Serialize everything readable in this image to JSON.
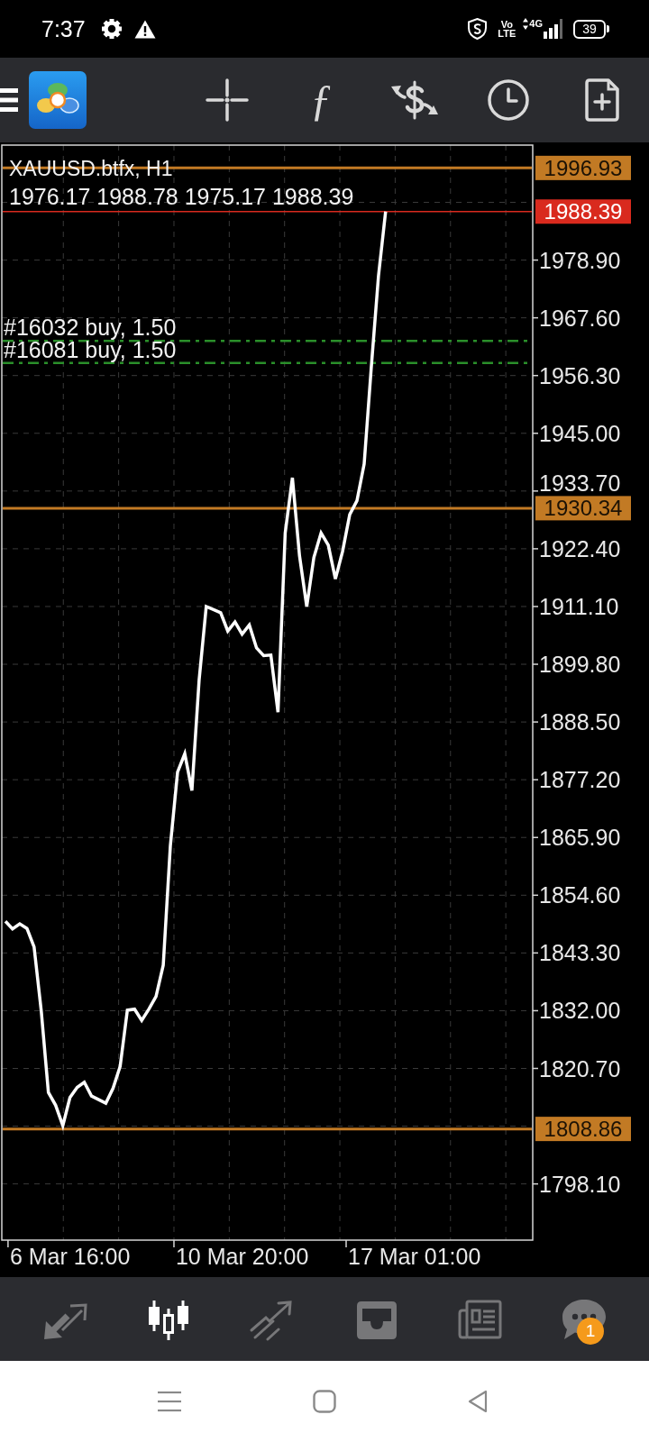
{
  "status_bar": {
    "time": "7:37",
    "volte_top": "Vo",
    "volte_bottom": "LTE",
    "network": "4G",
    "battery": "39"
  },
  "toolbar": {
    "function_symbol": "ƒ"
  },
  "chart": {
    "ohlc": "1976.17 1988.78 1975.17 1988.39",
    "chart_data": {
      "type": "line",
      "title": "XAUUSD.btfx, H1",
      "grid": true,
      "categories": [
        null,
        null,
        null,
        null,
        null,
        null,
        null,
        null,
        null,
        "6 Mar 16:00",
        null,
        null,
        null,
        null,
        null,
        null,
        null,
        null,
        null,
        null,
        null,
        null,
        null,
        null,
        null,
        null,
        null,
        null,
        null,
        null,
        null,
        null,
        null,
        "10 Mar 20:00",
        null,
        null,
        null,
        null,
        null,
        null,
        null,
        null,
        null,
        null,
        null,
        null,
        null,
        null,
        null,
        null,
        null,
        null,
        null,
        null,
        null,
        null,
        null,
        "17 Mar 01:00",
        null,
        null,
        null,
        null,
        null,
        null,
        null,
        null,
        null,
        null,
        null,
        null,
        null,
        null,
        null,
        null
      ],
      "series": [
        {
          "color": "#ffffff",
          "values": [
            1849.5,
            1848.0,
            1849.0,
            1848.1,
            1844.5,
            1831.9,
            1816.0,
            1813.5,
            1809.5,
            1815.0,
            1817.0,
            1818.0,
            1815.3,
            1814.6,
            1813.9,
            1816.8,
            1821.1,
            1832.1,
            1832.3,
            1830.1,
            1832.3,
            1834.8,
            1840.9,
            1864.3,
            1878.7,
            1882.3,
            1875.1,
            1896.7,
            1911.1,
            1910.5,
            1909.9,
            1906.3,
            1908.1,
            1905.7,
            1907.5,
            1903.0,
            1901.5,
            1901.6,
            1890.4,
            1925.5,
            1936.3,
            1921.0,
            1911.1,
            1920.7,
            1925.5,
            1923.1,
            1916.5,
            1921.9,
            1929.1,
            1931.8,
            1939.0,
            1957.9,
            1975.8,
            1988.4,
            null,
            null,
            null,
            null,
            null,
            null,
            null,
            null,
            null,
            null,
            null,
            null,
            null,
            null,
            null,
            null,
            null,
            null,
            null,
            null
          ]
        }
      ],
      "ylim": [
        1787.1,
        2001.4
      ],
      "yticks": [
        {
          "value": 1978.9,
          "label": "1978.90"
        },
        {
          "value": 1967.6,
          "label": "1967.60"
        },
        {
          "value": 1956.3,
          "label": "1956.30"
        },
        {
          "value": 1945.0,
          "label": "1945.00"
        },
        {
          "value": 1933.7,
          "label": "1933.70"
        },
        {
          "value": 1922.4,
          "label": "1922.40"
        },
        {
          "value": 1911.1,
          "label": "1911.10"
        },
        {
          "value": 1899.8,
          "label": "1899.80"
        },
        {
          "value": 1888.5,
          "label": "1888.50"
        },
        {
          "value": 1877.2,
          "label": "1877.20"
        },
        {
          "value": 1865.9,
          "label": "1865.90"
        },
        {
          "value": 1854.6,
          "label": "1854.60"
        },
        {
          "value": 1843.3,
          "label": "1843.30"
        },
        {
          "value": 1832.0,
          "label": "1832.00"
        },
        {
          "value": 1820.7,
          "label": "1820.70"
        },
        {
          "value": 1798.1,
          "label": "1798.10"
        }
      ],
      "ref_lines": [
        {
          "axis": "y",
          "value": 1996.93,
          "label": "1996.93",
          "color": "#c27a24"
        },
        {
          "axis": "y",
          "value": 1988.39,
          "label": "1988.39",
          "color": "#d92a1e"
        },
        {
          "axis": "y",
          "value": 1963.06,
          "color": "#2a8f2a"
        },
        {
          "axis": "y",
          "value": 1958.74,
          "color": "#2a8f2a"
        },
        {
          "axis": "y",
          "value": 1930.34,
          "label": "1930.34",
          "color": "#c27a24"
        },
        {
          "axis": "y",
          "value": 1808.86,
          "label": "1808.86",
          "color": "#c27a24"
        }
      ],
      "annotations": [
        "#16032 buy, 1.50",
        "#16081 buy, 1.50"
      ]
    }
  },
  "bottom_nav": {
    "items": [
      {
        "selected": false
      },
      {
        "selected": true
      },
      {
        "selected": false
      },
      {
        "selected": false
      },
      {
        "selected": false
      },
      {
        "selected": false,
        "badge": "1"
      }
    ]
  }
}
